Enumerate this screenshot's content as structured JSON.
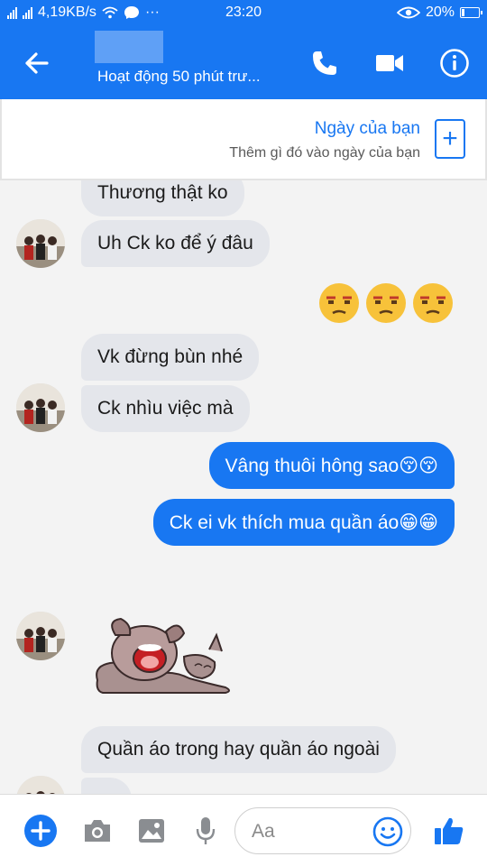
{
  "status_bar": {
    "net_speed": "4,19KB/s",
    "time": "23:20",
    "battery": "20%",
    "battery_level": 0.2
  },
  "header": {
    "status": "Hoạt động 50 phút trư..."
  },
  "banner": {
    "title": "Ngày của bạn",
    "subtitle": "Thêm gì đó vào ngày của bạn",
    "add_label": "+"
  },
  "messages": [
    {
      "dir": "in",
      "text": "Thương thật ko"
    },
    {
      "dir": "in",
      "text": "Uh Ck ko để ý đâu"
    },
    {
      "dir": "out",
      "type": "emoji",
      "icons": [
        "unamused-face-icon",
        "unamused-face-icon",
        "unamused-face-icon"
      ]
    },
    {
      "dir": "in",
      "text": "Vk đừng bùn nhé"
    },
    {
      "dir": "in",
      "text": "Ck nhìu việc mà"
    },
    {
      "dir": "out",
      "text": "Vâng thuôi hông sao😚😚"
    },
    {
      "dir": "out",
      "text": "Ck ei vk thích mua quần áo😁😁"
    },
    {
      "dir": "in",
      "type": "sticker",
      "icon": "crying-dog-sticker"
    },
    {
      "dir": "in",
      "text": "Quần áo trong hay quần áo ngoài"
    }
  ],
  "composer": {
    "placeholder": "Aa"
  },
  "colors": {
    "brand": "#1877f2",
    "incoming_bubble": "#e4e6eb",
    "background": "#f3f3f3"
  }
}
